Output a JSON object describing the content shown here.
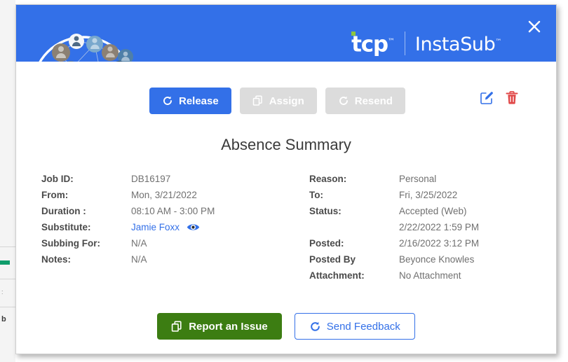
{
  "header": {
    "brand_primary": "tcp",
    "brand_primary_tm": "™",
    "brand_secondary": "InstaSub",
    "brand_secondary_tm": "™",
    "close_label": "×",
    "background_color": "#3370e8",
    "accent_green": "#8dc63f"
  },
  "actions": {
    "release_label": "Release",
    "assign_label": "Assign",
    "resend_label": "Resend",
    "release_enabled": true,
    "assign_enabled": false,
    "resend_enabled": false,
    "edit_icon": "edit-pencil-icon",
    "delete_icon": "trash-icon"
  },
  "main": {
    "title": "Absence Summary",
    "left_fields": [
      {
        "label": "Job ID:",
        "value": "DB16197",
        "link": false
      },
      {
        "label": "From:",
        "value": "Mon, 3/21/2022",
        "link": false
      },
      {
        "label": "Duration :",
        "value": "08:10 AM - 3:00 PM",
        "link": false
      },
      {
        "label": "Substitute:",
        "value": "Jamie Foxx",
        "link": true,
        "eye": true
      },
      {
        "label": "Subbing For:",
        "value": "N/A",
        "link": false
      },
      {
        "label": "Notes:",
        "value": "N/A",
        "link": false
      }
    ],
    "right_fields": [
      {
        "label": "Reason:",
        "value": "Personal"
      },
      {
        "label": "To:",
        "value": "Fri, 3/25/2022"
      },
      {
        "label": "Status:",
        "value": "Accepted (Web)"
      },
      {
        "label": "",
        "value": "2/22/2022 1:59 PM"
      },
      {
        "label": "Posted:",
        "value": "2/16/2022 3:12 PM"
      },
      {
        "label": "Posted By",
        "value": "Beyonce Knowles"
      },
      {
        "label": "Attachment:",
        "value": "No Attachment"
      }
    ]
  },
  "footer": {
    "report_label": "Report an Issue",
    "feedback_label": "Send Feedback",
    "report_color": "#3c7d12",
    "feedback_color": "#3370e8"
  },
  "colors": {
    "brand_blue": "#3370e8",
    "link_blue": "#3370e8",
    "green": "#3c7d12",
    "red": "#e04646",
    "disabled_gray": "#dcdcdc"
  }
}
